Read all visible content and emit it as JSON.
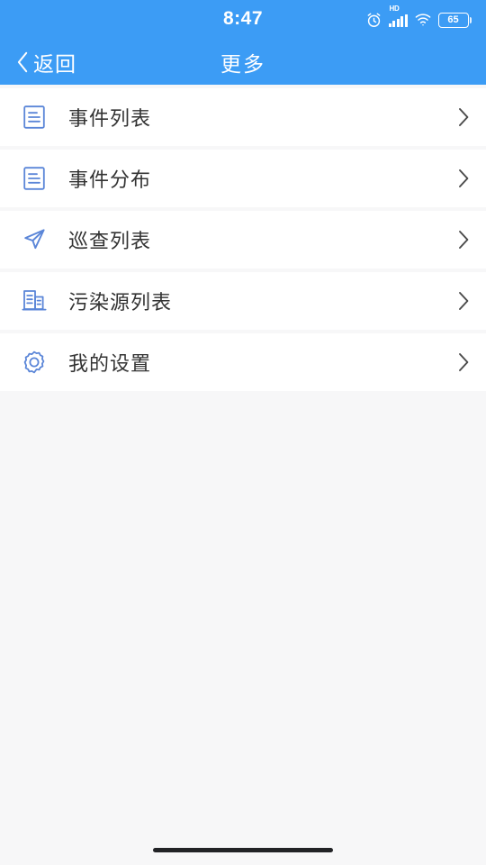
{
  "status_bar": {
    "time": "8:47",
    "alarm_icon": "alarm-clock-icon",
    "network_label": "HD",
    "signal_icon": "signal-bars-icon",
    "wifi_icon": "wifi-icon",
    "battery_percent": "65",
    "battery_icon": "battery-icon"
  },
  "nav_bar": {
    "back_icon": "chevron-left-icon",
    "back_label": "返回",
    "title": "更多"
  },
  "theme": {
    "primary": "#3c9cf5",
    "icon_blue": "#5b86d8",
    "page_bg": "#f7f7f8",
    "row_bg": "#ffffff",
    "text": "#333333",
    "chevron": "#4a4a4a"
  },
  "menu": {
    "items": [
      {
        "label": "事件列表",
        "icon": "document-list-icon",
        "chevron": "chevron-right-icon"
      },
      {
        "label": "事件分布",
        "icon": "document-list-icon",
        "chevron": "chevron-right-icon"
      },
      {
        "label": "巡查列表",
        "icon": "navigation-arrow-icon",
        "chevron": "chevron-right-icon"
      },
      {
        "label": "污染源列表",
        "icon": "building-icon",
        "chevron": "chevron-right-icon"
      },
      {
        "label": "我的设置",
        "icon": "gear-icon",
        "chevron": "chevron-right-icon"
      }
    ]
  },
  "home_indicator": {
    "name": "home-indicator-bar"
  }
}
